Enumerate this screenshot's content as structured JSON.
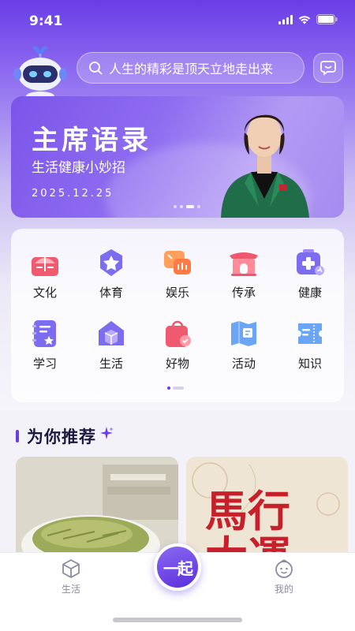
{
  "status_bar": {
    "time": "9:41"
  },
  "search": {
    "text": "人生的精彩是顶天立地走出来"
  },
  "banner": {
    "title": "主席语录",
    "subtitle": "生活健康小妙招",
    "date": "2025.12.25"
  },
  "categories": [
    {
      "label": "文化",
      "icon": "culture-book-icon"
    },
    {
      "label": "体育",
      "icon": "sports-medal-icon"
    },
    {
      "label": "娱乐",
      "icon": "entertainment-chat-icon"
    },
    {
      "label": "传承",
      "icon": "heritage-gate-icon"
    },
    {
      "label": "健康",
      "icon": "health-kit-icon"
    },
    {
      "label": "学习",
      "icon": "study-notebook-icon"
    },
    {
      "label": "生活",
      "icon": "life-home-icon"
    },
    {
      "label": "好物",
      "icon": "goods-bag-icon"
    },
    {
      "label": "活动",
      "icon": "activity-map-icon"
    },
    {
      "label": "知识",
      "icon": "knowledge-ticket-icon"
    }
  ],
  "recommend": {
    "title": "为你推荐"
  },
  "cards": [
    {
      "name": "green-tea-card",
      "text": ""
    },
    {
      "name": "calligraphy-card",
      "text": "馬行大運"
    }
  ],
  "tabbar": {
    "left_label": "生活",
    "center_label": "一起",
    "right_label": "我的"
  },
  "colors": {
    "accent": "#6a3de6",
    "tab_inactive": "#8b8aa3"
  }
}
